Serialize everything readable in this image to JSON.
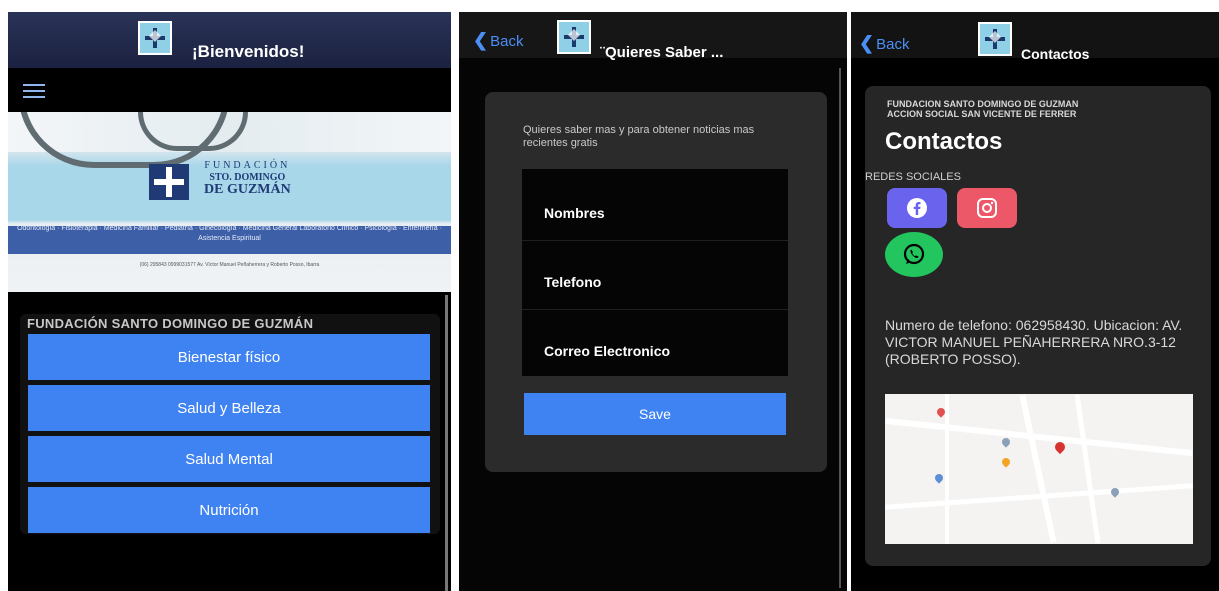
{
  "screen1": {
    "title": "¡Bienvenidos!",
    "banner": {
      "fund_line1": "FUNDACIÓN",
      "fund_line2": "STO. DOMINGO",
      "fund_line3": "DE GUZMÁN",
      "services": "Odontología · Fisioterapia · Medicina Familiar · Pediatría · Ginecología · Medicina General Laboratorio Clínico · Psicología · Enfermería · Asistencia Espiritual",
      "contact": "(06) 295843   0999031577   Av. Víctor Manuel Peñaherrera y Roberto Posso, Ibarra"
    },
    "panel_title": "FUNDACIÓN SANTO DOMINGO DE GUZMÁN",
    "buttons": [
      "Bienestar físico",
      "Salud y Belleza",
      "Salud Mental",
      "Nutrición"
    ]
  },
  "screen2": {
    "back_label": "Back",
    "title": "¨Quieres Saber ...",
    "intro": "Quieres saber mas y para obtener noticias mas recientes gratis",
    "fields": [
      "Nombres",
      "Telefono",
      "Correo Electronico"
    ],
    "save_label": "Save"
  },
  "screen3": {
    "back_label": "Back",
    "title": "Contactos",
    "org_line1": "FUNDACION SANTO DOMINGO DE GUZMAN",
    "org_line2": "ACCION SOCIAL SAN VICENTE DE FERRER",
    "heading": "Contactos",
    "social_label": "REDES SOCIALES",
    "info": "Numero de telefono: 062958430. Ubicacion: AV. VICTOR MANUEL PEÑAHERRERA NRO.3-12 (ROBERTO POSSO)."
  },
  "colors": {
    "button_blue": "#3f82f1",
    "back_blue": "#4b8ff5",
    "facebook": "#6a63ee",
    "instagram": "#ec5868",
    "whatsapp": "#22c55e"
  }
}
